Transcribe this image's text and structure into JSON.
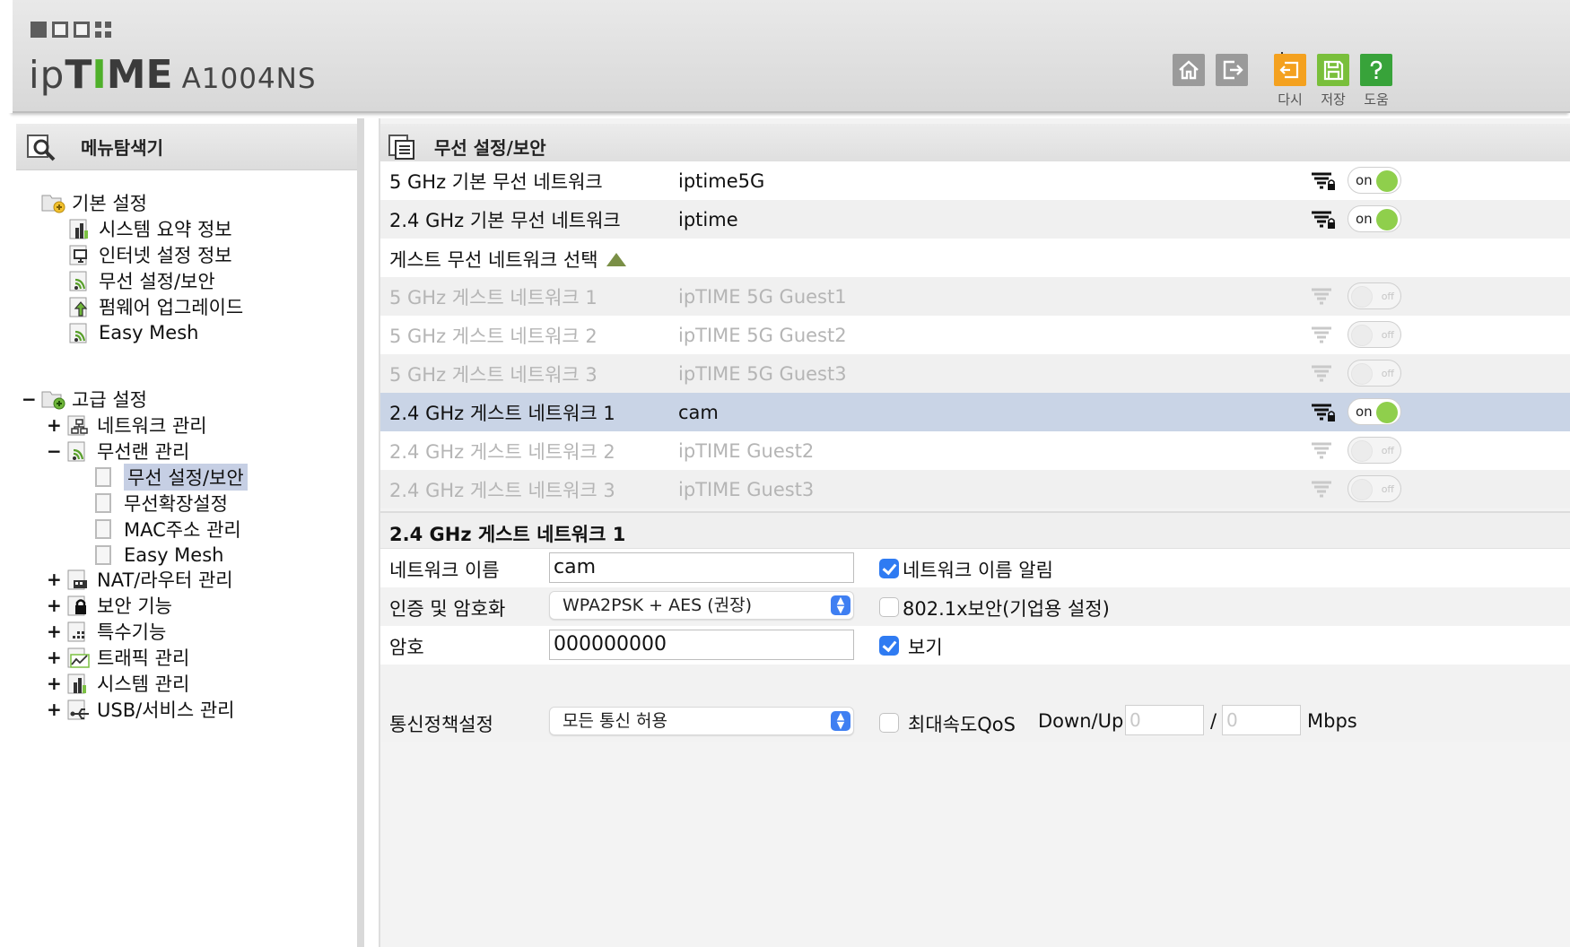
{
  "header": {
    "brand_ip": "ip",
    "brand_time_1": "T",
    "brand_time_2": "I",
    "brand_time_3": "ME",
    "model": "A1004NS",
    "buttons": [
      {
        "name": "home",
        "label": ""
      },
      {
        "name": "logout",
        "label": ""
      },
      {
        "name": "reset",
        "label": "다시"
      },
      {
        "name": "save",
        "label": "저장"
      },
      {
        "name": "help",
        "label": "도움"
      }
    ],
    "colors": {
      "reset": "#f4a11f",
      "save": "#79bf3b",
      "help": "#38a33a",
      "gray": "#9a9a9a"
    }
  },
  "sidebar": {
    "title": "메뉴탐색기",
    "basic": {
      "label": "기본 설정",
      "items": [
        "시스템 요약 정보",
        "인터넷 설정 정보",
        "무선 설정/보안",
        "펌웨어 업그레이드",
        "Easy Mesh"
      ]
    },
    "advanced": {
      "toggle": "−",
      "label": "고급 설정",
      "items": [
        {
          "toggle": "+",
          "label": "네트워크 관리"
        },
        {
          "toggle": "−",
          "label": "무선랜 관리",
          "children": [
            "무선 설정/보안",
            "무선확장설정",
            "MAC주소 관리",
            "Easy Mesh"
          ]
        },
        {
          "toggle": "+",
          "label": "NAT/라우터 관리"
        },
        {
          "toggle": "+",
          "label": "보안 기능"
        },
        {
          "toggle": "+",
          "label": "특수기능"
        },
        {
          "toggle": "+",
          "label": "트래픽 관리"
        },
        {
          "toggle": "+",
          "label": "시스템 관리"
        },
        {
          "toggle": "+",
          "label": "USB/서비스 관리"
        }
      ]
    },
    "selected": "무선 설정/보안"
  },
  "main": {
    "title": "무선 설정/보안",
    "networks": [
      {
        "name": "5 GHz 기본 무선 네트워크",
        "ssid": "iptime5G",
        "state": "on"
      },
      {
        "name": "2.4 GHz 기본 무선 네트워크",
        "ssid": "iptime",
        "state": "on"
      }
    ],
    "guest_header": "게스트 무선 네트워크 선택",
    "guests": [
      {
        "name": "5 GHz 게스트 네트워크 1",
        "ssid": "ipTIME 5G Guest1",
        "state": "off"
      },
      {
        "name": "5 GHz 게스트 네트워크 2",
        "ssid": "ipTIME 5G Guest2",
        "state": "off"
      },
      {
        "name": "5 GHz 게스트 네트워크 3",
        "ssid": "ipTIME 5G Guest3",
        "state": "off"
      },
      {
        "name": "2.4 GHz 게스트 네트워크 1",
        "ssid": "cam",
        "state": "on"
      },
      {
        "name": "2.4 GHz 게스트 네트워크 2",
        "ssid": "ipTIME Guest2",
        "state": "off"
      },
      {
        "name": "2.4 GHz 게스트 네트워크 3",
        "ssid": "ipTIME Guest3",
        "state": "off"
      }
    ],
    "toggle_on_text": "on",
    "toggle_off_text": "off",
    "detail": {
      "title": "2.4 GHz 게스트 네트워크 1",
      "network_name_label": "네트워크 이름",
      "network_name_value": "cam",
      "broadcast_label": "네트워크 이름 알림",
      "broadcast_checked": true,
      "auth_label": "인증 및 암호화",
      "auth_value": "WPA2PSK + AES (권장)",
      "enterprise_label": "802.1x보안(기업용 설정)",
      "enterprise_checked": false,
      "password_label": "암호",
      "password_value": "000000000",
      "show_label": "보기",
      "show_checked": true,
      "policy_label": "통신정책설정",
      "policy_value": "모든 통신 허용",
      "qos_label": "최대속도QoS",
      "qos_checked": false,
      "downup_label": "Down/Up",
      "down_value": "0",
      "up_value": "0",
      "slash": "/",
      "unit": "Mbps"
    }
  }
}
